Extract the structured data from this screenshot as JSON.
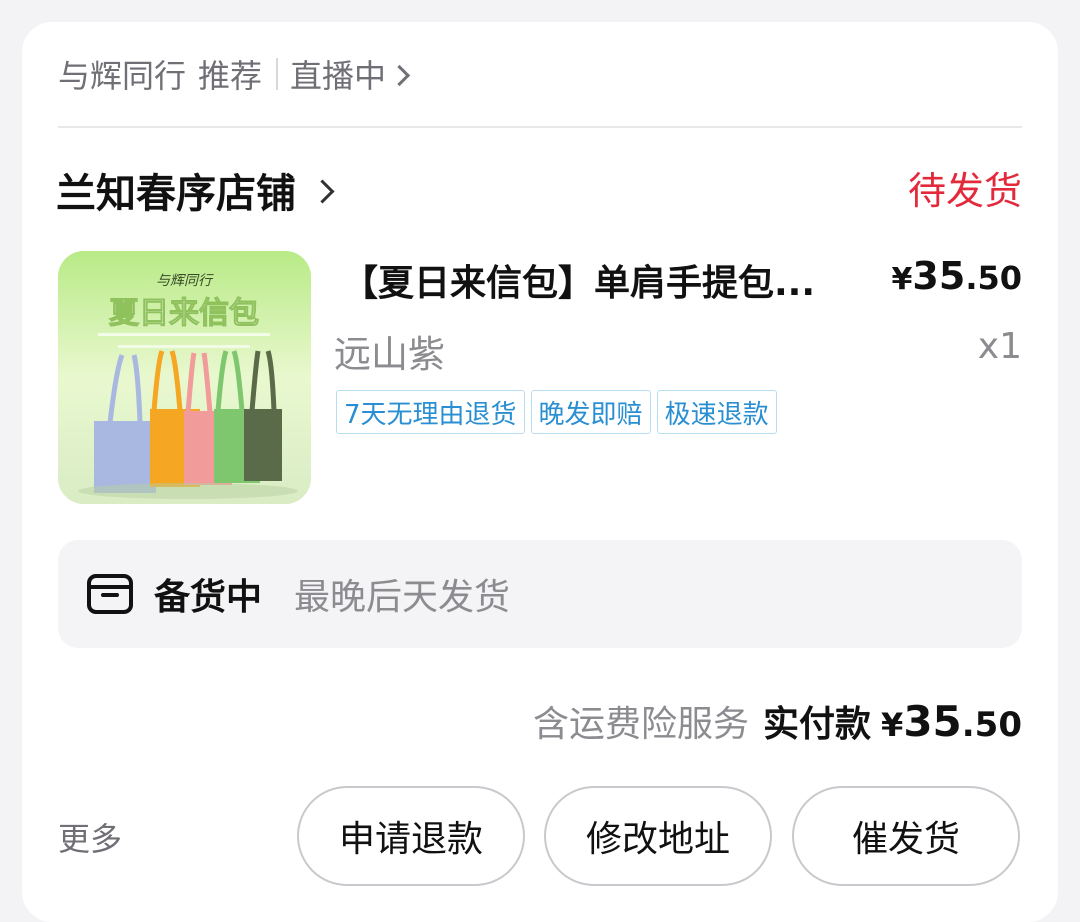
{
  "source": {
    "account": "与辉同行",
    "recommend": "推荐",
    "live": "直播中"
  },
  "store": {
    "name": "兰知春序店铺",
    "status": "待发货",
    "status_color": "#e32a3c"
  },
  "product": {
    "image_caption": "夏日来信包",
    "image_brand": "与辉同行",
    "title": "【夏日来信包】单肩手提包...",
    "price_currency": "¥",
    "price_int": "35",
    "price_dec": ".50",
    "variant": "远山紫",
    "qty": "x1",
    "tags": [
      "7天无理由退货",
      "晚发即赔",
      "极速退款"
    ],
    "bag_colors": [
      "#a8b8e0",
      "#f5a623",
      "#f29b9b",
      "#7fc76f",
      "#5a6b4a"
    ]
  },
  "stock": {
    "label": "备货中",
    "sub": "最晚后天发货"
  },
  "total": {
    "insurance": "含运费险服务",
    "paid_label": "实付款",
    "currency": "¥",
    "int": "35",
    "dec": ".50"
  },
  "actions": {
    "more": "更多",
    "refund": "申请退款",
    "address": "修改地址",
    "urge": "催发货"
  },
  "accent_tag_color": "#2a8fd2"
}
